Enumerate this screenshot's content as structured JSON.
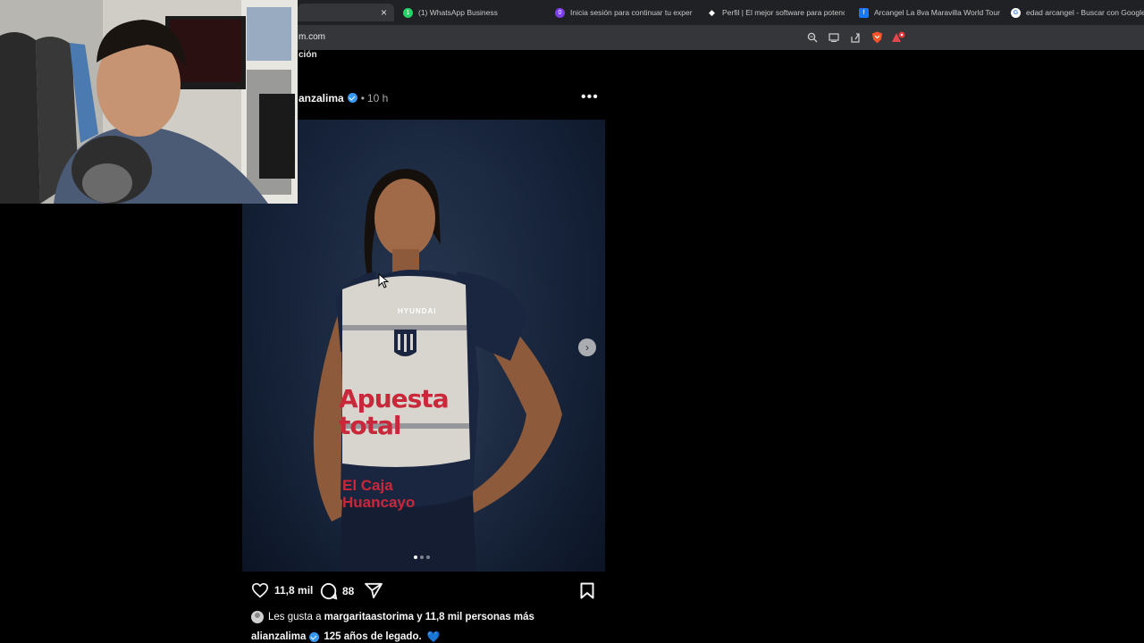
{
  "browser": {
    "tabs": [
      {
        "label": "",
        "active": true,
        "fav_color": "#35363a"
      },
      {
        "label": "(1) WhatsApp Business",
        "fav_color": "#25d366",
        "fav_glyph": "1"
      },
      {
        "label": "Inicia sesión para continuar tu experi",
        "fav_color": "#7b3fe4",
        "fav_glyph": "0"
      },
      {
        "label": "Perfil | El mejor software para potenc",
        "fav_color": "#ffffff",
        "fav_glyph": "◆"
      },
      {
        "label": "Arcangel La 8va Maravilla World Tour",
        "fav_color": "#1877f2",
        "fav_glyph": "f"
      },
      {
        "label": "edad arcangel - Buscar con Google",
        "fav_color": "#ffffff",
        "fav_glyph": "G"
      }
    ],
    "url": "m.com",
    "toolbar_icons": [
      "zoom-icon",
      "cast-icon",
      "share-icon",
      "brave-shield-icon",
      "brave-rewards-icon"
    ]
  },
  "page": {
    "crumb": "ción"
  },
  "post": {
    "username": "anzalima",
    "separator": "•",
    "time": "10 h",
    "more_glyph": "•••",
    "next_glyph": "›",
    "carousel_total": 3,
    "carousel_index": 1,
    "like_count": "11,8 mil",
    "comment_count": "88",
    "liked_by_prefix": "Les gusta a ",
    "liked_by_user": "margaritaastorima",
    "liked_by_suffix": " y 11,8 mil personas más",
    "caption_user": "alianzalima",
    "caption_text": "125 años de legado.",
    "caption_emoji": "💙",
    "jersey_text": {
      "sponsor_1": "Apuesta total",
      "sponsor_2": "El Caja Huancayo",
      "brand": "HYUNDAI"
    }
  },
  "colors": {
    "accent_verified": "#3897f0",
    "heart_emoji": "#3d7be8"
  }
}
